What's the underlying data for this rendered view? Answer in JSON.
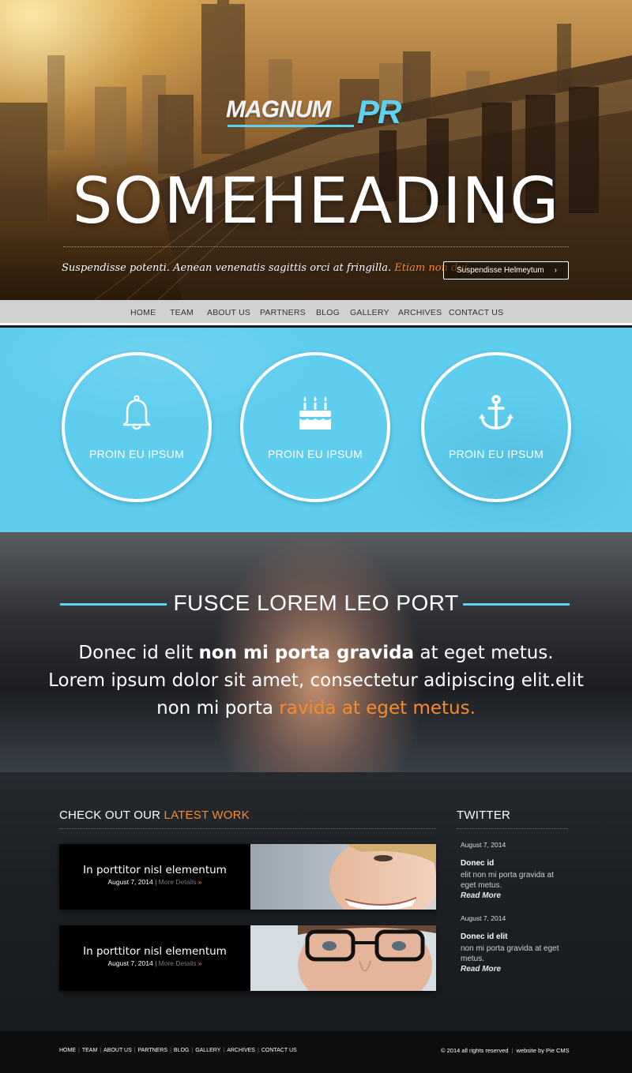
{
  "brand": {
    "logo_main": "MAGNUM",
    "logo_accent": "PR"
  },
  "hero": {
    "heading": "SOMEHEADING",
    "tagline": "Suspendisse potenti. Aenean venenatis sagittis orci at fringilla.",
    "tagline_accent": "Etiam non dui",
    "button_label": "Suspendisse Helmeytum",
    "button_icon": "chevron-right-icon"
  },
  "nav": {
    "items": [
      "HOME",
      "TEAM",
      "ABOUT US",
      "PARTNERS",
      "BLOG",
      "GALLERY",
      "ARCHIVES",
      "CONTACT US"
    ]
  },
  "services": [
    {
      "label": "PROIN EU IPSUM",
      "icon": "bell-icon"
    },
    {
      "label": "PROIN EU IPSUM",
      "icon": "birthday-cake-icon"
    },
    {
      "label": "PROIN EU IPSUM",
      "icon": "anchor-icon"
    }
  ],
  "quote": {
    "title": "FUSCE LOREM LEO PORT",
    "part1": "Donec id elit ",
    "bold": "non mi porta gravida",
    "part2": " at eget metus. Lorem ipsum dolor sit amet, consectetur adipiscing elit.elit non mi porta ",
    "accent": "ravida at eget metus."
  },
  "work": {
    "title_plain": "CHECK OUT OUR ",
    "title_accent": "LATEST WORK",
    "items": [
      {
        "title": "In porttitor nisl elementum",
        "date": "August 7, 2014",
        "sep": "|",
        "more": "More Details",
        "raquo": "»"
      },
      {
        "title": "In porttitor nisl elementum",
        "date": "August 7, 2014",
        "sep": "|",
        "more": "More Details",
        "raquo": "»"
      }
    ]
  },
  "twitter": {
    "title": "TWITTER",
    "tweets": [
      {
        "date": "August 7, 2014",
        "name": "Donec id",
        "body": "elit non mi porta gravida at eget metus.",
        "more": "Read More"
      },
      {
        "date": "August 7, 2014",
        "name": "Donec id elit",
        "body": "non mi porta gravida at eget metus.",
        "more": "Read More"
      }
    ]
  },
  "footer": {
    "nav": [
      "HOME",
      "TEAM",
      "ABOUT US",
      "PARTNERS",
      "BLOG",
      "GALLERY",
      "ARCHIVES",
      "CONTACT US"
    ],
    "separator": "|",
    "copyright": "© 2014 all rights reserved",
    "credit": "website by Pie CMS"
  },
  "colors": {
    "accent_blue": "#5dd3f2",
    "accent_orange": "#f68b2c",
    "services_bg": "#5ecdee",
    "nav_bg": "#d1d1d1"
  }
}
